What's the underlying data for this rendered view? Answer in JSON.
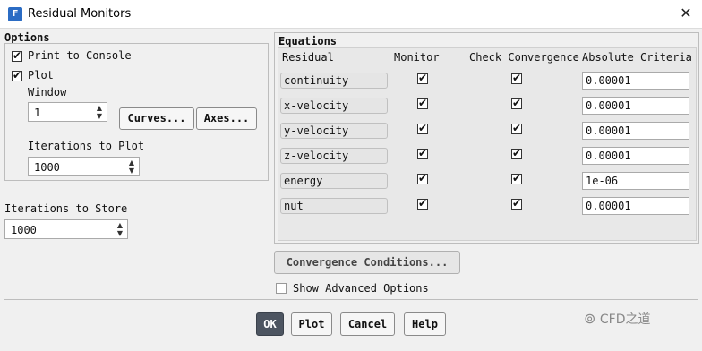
{
  "window": {
    "title": "Residual Monitors",
    "app_icon_letter": "F"
  },
  "options": {
    "title": "Options",
    "print_to_console": {
      "label": "Print to Console",
      "checked": true
    },
    "plot": {
      "label": "Plot",
      "checked": true
    },
    "window_label": "Window",
    "window_value": "1",
    "curves_label": "Curves...",
    "axes_label": "Axes...",
    "iterations_to_plot_label": "Iterations to Plot",
    "iterations_to_plot_value": "1000"
  },
  "store": {
    "label": "Iterations to Store",
    "value": "1000"
  },
  "equations": {
    "title": "Equations",
    "headers": {
      "residual": "Residual",
      "monitor": "Monitor",
      "check": "Check Convergence",
      "criteria": "Absolute Criteria"
    },
    "rows": [
      {
        "name": "continuity",
        "monitor": true,
        "check": true,
        "criteria": "0.00001"
      },
      {
        "name": "x-velocity",
        "monitor": true,
        "check": true,
        "criteria": "0.00001"
      },
      {
        "name": "y-velocity",
        "monitor": true,
        "check": true,
        "criteria": "0.00001"
      },
      {
        "name": "z-velocity",
        "monitor": true,
        "check": true,
        "criteria": "0.00001"
      },
      {
        "name": "energy",
        "monitor": true,
        "check": true,
        "criteria": "1e-06"
      },
      {
        "name": "nut",
        "monitor": true,
        "check": true,
        "criteria": "0.00001"
      }
    ]
  },
  "convergence_conditions_label": "Convergence Conditions...",
  "show_advanced": {
    "label": "Show Advanced Options",
    "checked": false
  },
  "buttons": {
    "ok": "OK",
    "plot": "Plot",
    "cancel": "Cancel",
    "help": "Help"
  },
  "watermark": "CFD之道"
}
